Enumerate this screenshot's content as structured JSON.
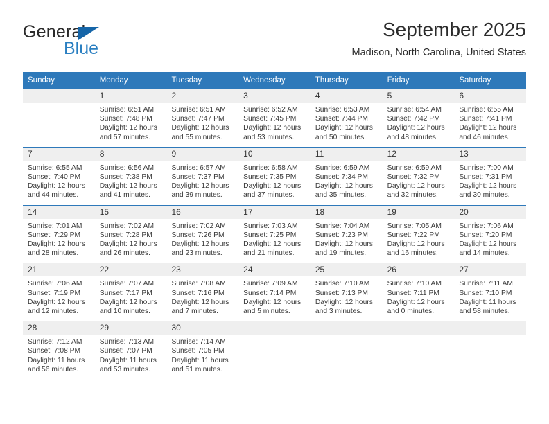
{
  "brand": {
    "name_part1": "General",
    "name_part2": "Blue",
    "accent_color": "#2a7fc1",
    "triangle_color": "#1565a8"
  },
  "header": {
    "title": "September 2025",
    "subtitle": "Madison, North Carolina, United States"
  },
  "calendar": {
    "header_bg": "#2e79ba",
    "weekdays": [
      "Sunday",
      "Monday",
      "Tuesday",
      "Wednesday",
      "Thursday",
      "Friday",
      "Saturday"
    ],
    "weeks": [
      [
        {
          "day": "",
          "lines": []
        },
        {
          "day": "1",
          "lines": [
            "Sunrise: 6:51 AM",
            "Sunset: 7:48 PM",
            "Daylight: 12 hours",
            "and 57 minutes."
          ]
        },
        {
          "day": "2",
          "lines": [
            "Sunrise: 6:51 AM",
            "Sunset: 7:47 PM",
            "Daylight: 12 hours",
            "and 55 minutes."
          ]
        },
        {
          "day": "3",
          "lines": [
            "Sunrise: 6:52 AM",
            "Sunset: 7:45 PM",
            "Daylight: 12 hours",
            "and 53 minutes."
          ]
        },
        {
          "day": "4",
          "lines": [
            "Sunrise: 6:53 AM",
            "Sunset: 7:44 PM",
            "Daylight: 12 hours",
            "and 50 minutes."
          ]
        },
        {
          "day": "5",
          "lines": [
            "Sunrise: 6:54 AM",
            "Sunset: 7:42 PM",
            "Daylight: 12 hours",
            "and 48 minutes."
          ]
        },
        {
          "day": "6",
          "lines": [
            "Sunrise: 6:55 AM",
            "Sunset: 7:41 PM",
            "Daylight: 12 hours",
            "and 46 minutes."
          ]
        }
      ],
      [
        {
          "day": "7",
          "lines": [
            "Sunrise: 6:55 AM",
            "Sunset: 7:40 PM",
            "Daylight: 12 hours",
            "and 44 minutes."
          ]
        },
        {
          "day": "8",
          "lines": [
            "Sunrise: 6:56 AM",
            "Sunset: 7:38 PM",
            "Daylight: 12 hours",
            "and 41 minutes."
          ]
        },
        {
          "day": "9",
          "lines": [
            "Sunrise: 6:57 AM",
            "Sunset: 7:37 PM",
            "Daylight: 12 hours",
            "and 39 minutes."
          ]
        },
        {
          "day": "10",
          "lines": [
            "Sunrise: 6:58 AM",
            "Sunset: 7:35 PM",
            "Daylight: 12 hours",
            "and 37 minutes."
          ]
        },
        {
          "day": "11",
          "lines": [
            "Sunrise: 6:59 AM",
            "Sunset: 7:34 PM",
            "Daylight: 12 hours",
            "and 35 minutes."
          ]
        },
        {
          "day": "12",
          "lines": [
            "Sunrise: 6:59 AM",
            "Sunset: 7:32 PM",
            "Daylight: 12 hours",
            "and 32 minutes."
          ]
        },
        {
          "day": "13",
          "lines": [
            "Sunrise: 7:00 AM",
            "Sunset: 7:31 PM",
            "Daylight: 12 hours",
            "and 30 minutes."
          ]
        }
      ],
      [
        {
          "day": "14",
          "lines": [
            "Sunrise: 7:01 AM",
            "Sunset: 7:29 PM",
            "Daylight: 12 hours",
            "and 28 minutes."
          ]
        },
        {
          "day": "15",
          "lines": [
            "Sunrise: 7:02 AM",
            "Sunset: 7:28 PM",
            "Daylight: 12 hours",
            "and 26 minutes."
          ]
        },
        {
          "day": "16",
          "lines": [
            "Sunrise: 7:02 AM",
            "Sunset: 7:26 PM",
            "Daylight: 12 hours",
            "and 23 minutes."
          ]
        },
        {
          "day": "17",
          "lines": [
            "Sunrise: 7:03 AM",
            "Sunset: 7:25 PM",
            "Daylight: 12 hours",
            "and 21 minutes."
          ]
        },
        {
          "day": "18",
          "lines": [
            "Sunrise: 7:04 AM",
            "Sunset: 7:23 PM",
            "Daylight: 12 hours",
            "and 19 minutes."
          ]
        },
        {
          "day": "19",
          "lines": [
            "Sunrise: 7:05 AM",
            "Sunset: 7:22 PM",
            "Daylight: 12 hours",
            "and 16 minutes."
          ]
        },
        {
          "day": "20",
          "lines": [
            "Sunrise: 7:06 AM",
            "Sunset: 7:20 PM",
            "Daylight: 12 hours",
            "and 14 minutes."
          ]
        }
      ],
      [
        {
          "day": "21",
          "lines": [
            "Sunrise: 7:06 AM",
            "Sunset: 7:19 PM",
            "Daylight: 12 hours",
            "and 12 minutes."
          ]
        },
        {
          "day": "22",
          "lines": [
            "Sunrise: 7:07 AM",
            "Sunset: 7:17 PM",
            "Daylight: 12 hours",
            "and 10 minutes."
          ]
        },
        {
          "day": "23",
          "lines": [
            "Sunrise: 7:08 AM",
            "Sunset: 7:16 PM",
            "Daylight: 12 hours",
            "and 7 minutes."
          ]
        },
        {
          "day": "24",
          "lines": [
            "Sunrise: 7:09 AM",
            "Sunset: 7:14 PM",
            "Daylight: 12 hours",
            "and 5 minutes."
          ]
        },
        {
          "day": "25",
          "lines": [
            "Sunrise: 7:10 AM",
            "Sunset: 7:13 PM",
            "Daylight: 12 hours",
            "and 3 minutes."
          ]
        },
        {
          "day": "26",
          "lines": [
            "Sunrise: 7:10 AM",
            "Sunset: 7:11 PM",
            "Daylight: 12 hours",
            "and 0 minutes."
          ]
        },
        {
          "day": "27",
          "lines": [
            "Sunrise: 7:11 AM",
            "Sunset: 7:10 PM",
            "Daylight: 11 hours",
            "and 58 minutes."
          ]
        }
      ],
      [
        {
          "day": "28",
          "lines": [
            "Sunrise: 7:12 AM",
            "Sunset: 7:08 PM",
            "Daylight: 11 hours",
            "and 56 minutes."
          ]
        },
        {
          "day": "29",
          "lines": [
            "Sunrise: 7:13 AM",
            "Sunset: 7:07 PM",
            "Daylight: 11 hours",
            "and 53 minutes."
          ]
        },
        {
          "day": "30",
          "lines": [
            "Sunrise: 7:14 AM",
            "Sunset: 7:05 PM",
            "Daylight: 11 hours",
            "and 51 minutes."
          ]
        },
        {
          "day": "",
          "lines": []
        },
        {
          "day": "",
          "lines": []
        },
        {
          "day": "",
          "lines": []
        },
        {
          "day": "",
          "lines": []
        }
      ]
    ]
  }
}
